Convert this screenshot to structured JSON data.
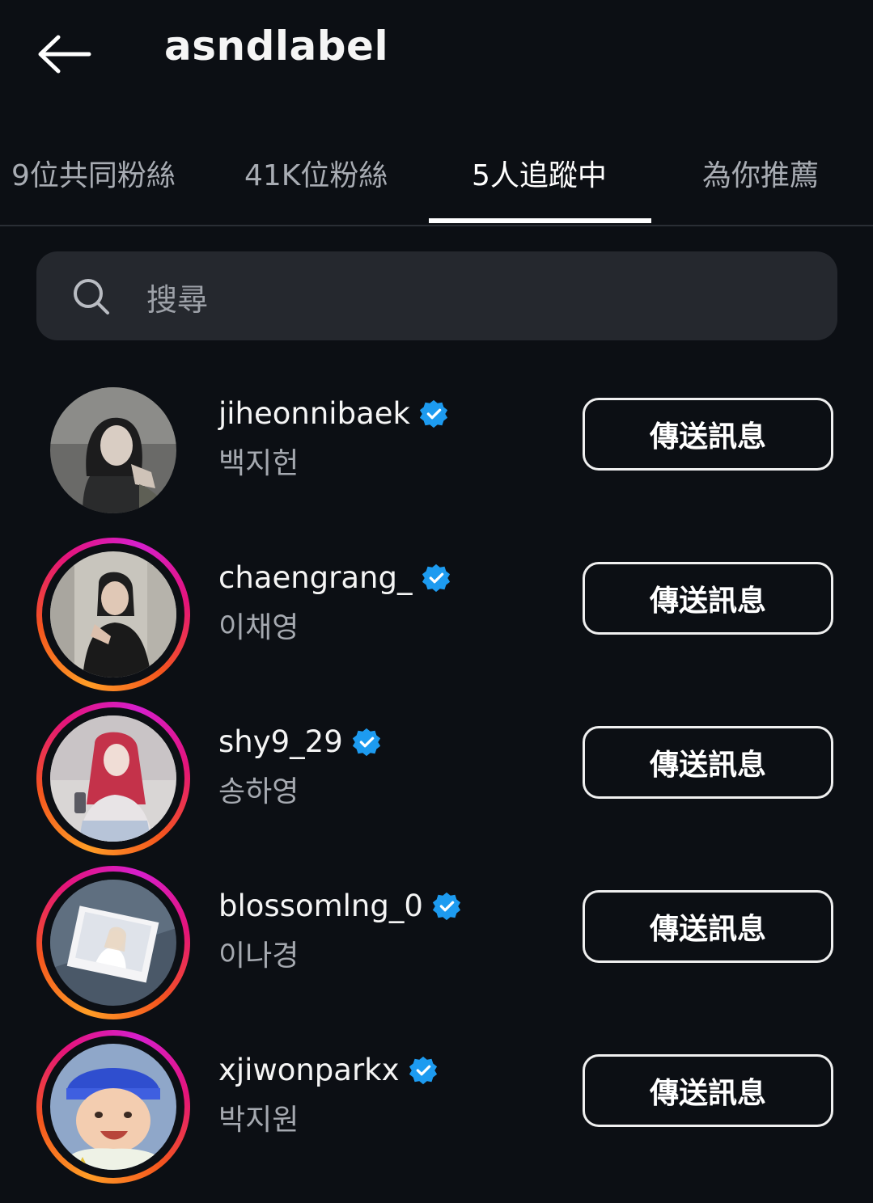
{
  "header": {
    "title": "asndlabel",
    "back_icon": "arrow-left-icon"
  },
  "tabs": [
    {
      "label": "9位共同粉絲",
      "active": false
    },
    {
      "label": "41K位粉絲",
      "active": false
    },
    {
      "label": "5人追蹤中",
      "active": true
    },
    {
      "label": "為你推薦",
      "active": false
    }
  ],
  "search": {
    "placeholder": "搜尋",
    "icon": "search-icon"
  },
  "accounts": [
    {
      "username": "jiheonnibaek",
      "name": "백지헌",
      "verified": true,
      "story_ring": false,
      "button": "傳送訊息"
    },
    {
      "username": "chaengrang_",
      "name": "이채영",
      "verified": true,
      "story_ring": true,
      "button": "傳送訊息"
    },
    {
      "username": "shy9_29",
      "name": "송하영",
      "verified": true,
      "story_ring": true,
      "button": "傳送訊息"
    },
    {
      "username": "blossomlng_0",
      "name": "이나경",
      "verified": true,
      "story_ring": true,
      "button": "傳送訊息"
    },
    {
      "username": "xjiwonparkx",
      "name": "박지원",
      "verified": true,
      "story_ring": true,
      "button": "傳送訊息"
    }
  ],
  "colors": {
    "background": "#0c0f14",
    "verified_badge": "#1d9bf0",
    "ring_orange": "#ff9d26",
    "ring_magenta": "#d61fcd"
  }
}
